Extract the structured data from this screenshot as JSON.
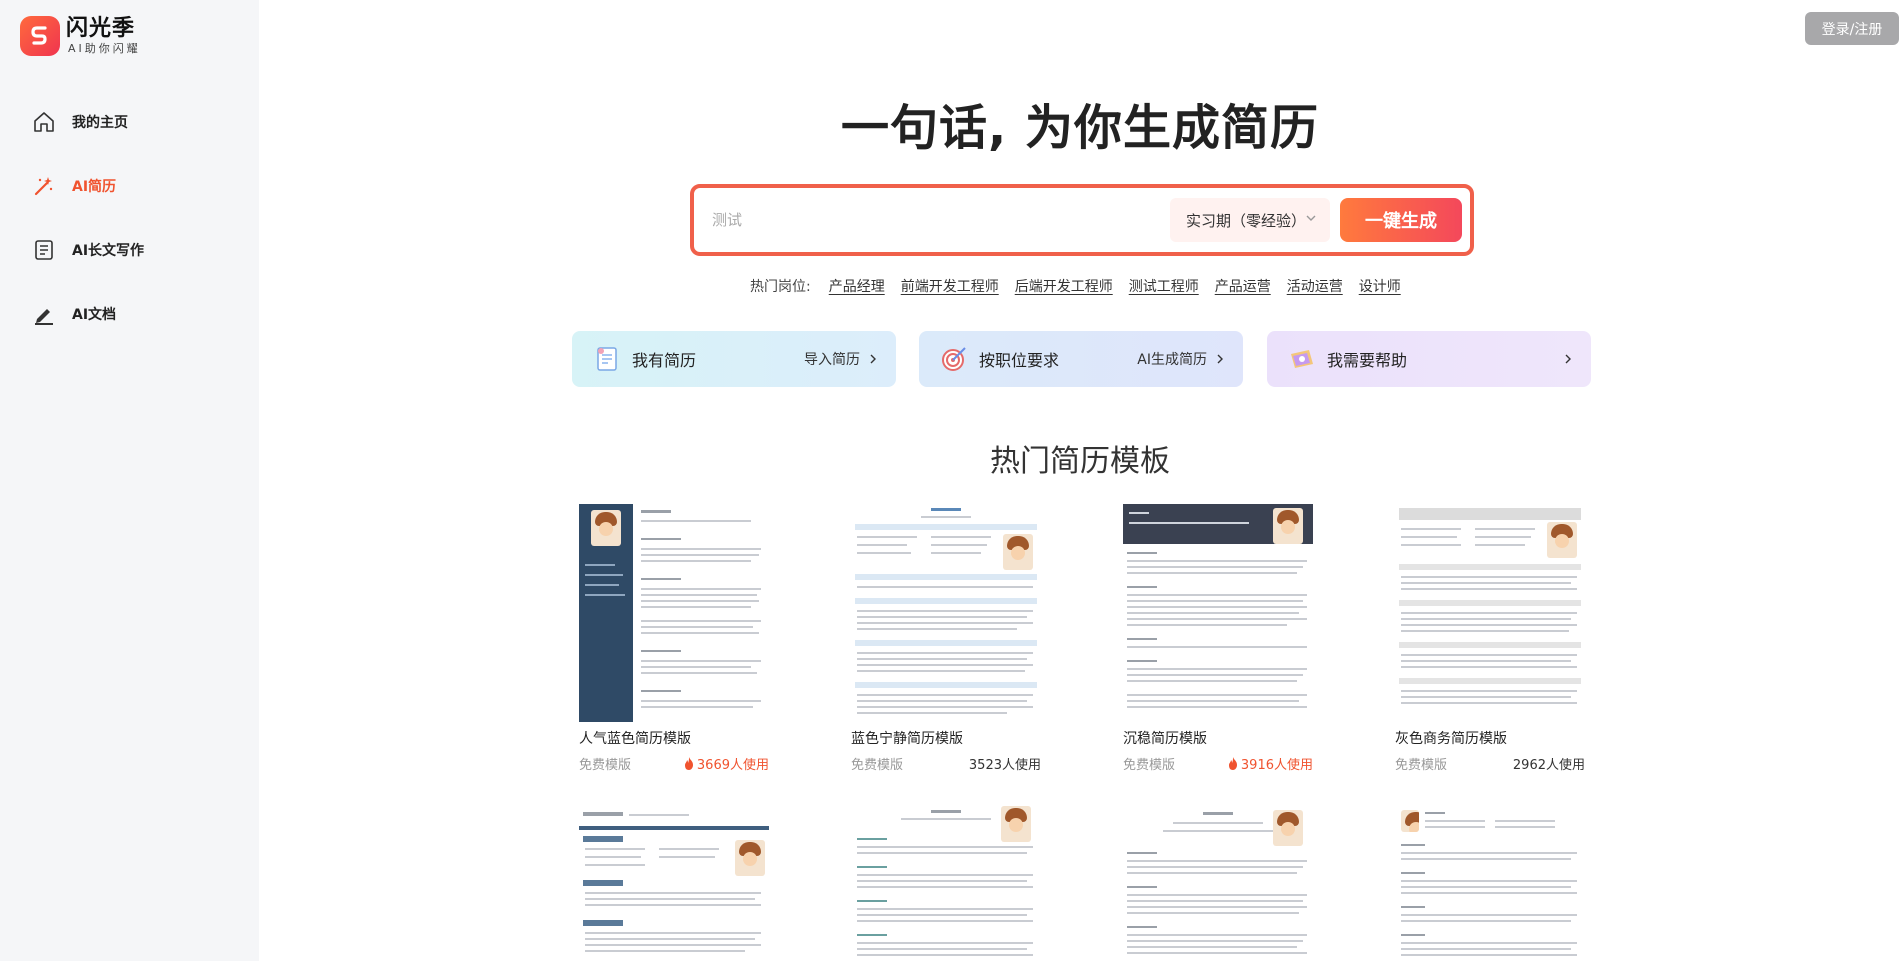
{
  "app": {
    "name": "闪光季",
    "tagline": "AI助你闪耀"
  },
  "sidebar": {
    "items": [
      {
        "label": "我的主页",
        "icon": "home-icon",
        "active": false
      },
      {
        "label": "AI简历",
        "icon": "magic-wand-icon",
        "active": true
      },
      {
        "label": "AI长文写作",
        "icon": "document-icon",
        "active": false
      },
      {
        "label": "AI文档",
        "icon": "pen-icon",
        "active": false
      }
    ]
  },
  "header": {
    "login_label": "登录/注册"
  },
  "hero": {
    "title": "一句话, 为你生成简历",
    "search_value": "",
    "search_placeholder": "测试",
    "stage_select": "实习期（零经验）",
    "generate_label": "一键生成",
    "hot_label": "热门岗位:",
    "hot_jobs": [
      "产品经理",
      "前端开发工程师",
      "后端开发工程师",
      "测试工程师",
      "产品运营",
      "活动运营",
      "设计师"
    ]
  },
  "actions": [
    {
      "title": "我有简历",
      "link": "导入简历",
      "icon": "resume-upload-icon"
    },
    {
      "title": "按职位要求",
      "link": "AI生成简历",
      "icon": "target-icon"
    },
    {
      "title": "我需要帮助",
      "link": "",
      "icon": "help-ticket-icon"
    }
  ],
  "templates_section": {
    "title": "热门简历模板",
    "items": [
      {
        "name": "人气蓝色简历模版",
        "tag": "免费模版",
        "users": "3669人使用",
        "hot": true
      },
      {
        "name": "蓝色宁静简历模版",
        "tag": "免费模版",
        "users": "3523人使用",
        "hot": false
      },
      {
        "name": "沉稳简历模版",
        "tag": "免费模版",
        "users": "3916人使用",
        "hot": true
      },
      {
        "name": "灰色商务简历模版",
        "tag": "免费模版",
        "users": "2962人使用",
        "hot": false
      }
    ]
  },
  "colors": {
    "accent": "#f0532f",
    "sidebar_bg": "#f5f6f8",
    "search_border": "#f0604a"
  }
}
